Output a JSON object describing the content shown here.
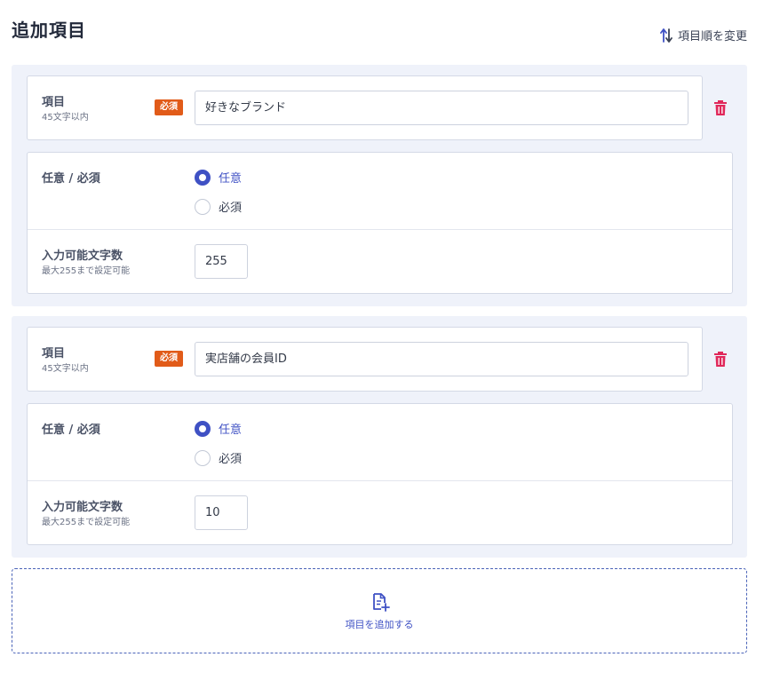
{
  "header": {
    "title": "追加項目",
    "reorder_label": "項目順を変更"
  },
  "blocks": [
    {
      "item_label": "項目",
      "item_hint": "45文字以内",
      "required_badge": "必須",
      "item_value": "好きなブランド",
      "required_label": "任意 / 必須",
      "option_optional": "任意",
      "option_required": "必須",
      "selected": "任意",
      "maxlen_label": "入力可能文字数",
      "maxlen_hint": "最大255まで設定可能",
      "maxlen_value": "255"
    },
    {
      "item_label": "項目",
      "item_hint": "45文字以内",
      "required_badge": "必須",
      "item_value": "実店舗の会員ID",
      "required_label": "任意 / 必須",
      "option_optional": "任意",
      "option_required": "必須",
      "selected": "任意",
      "maxlen_label": "入力可能文字数",
      "maxlen_hint": "最大255まで設定可能",
      "maxlen_value": "10"
    }
  ],
  "add_item": {
    "label": "項目を追加する",
    "icon": "file-add-icon"
  },
  "colors": {
    "accent": "#3f51c4",
    "badge": "#e15b19",
    "trash": "#e0285a",
    "panel_bg": "#eff2fa"
  }
}
